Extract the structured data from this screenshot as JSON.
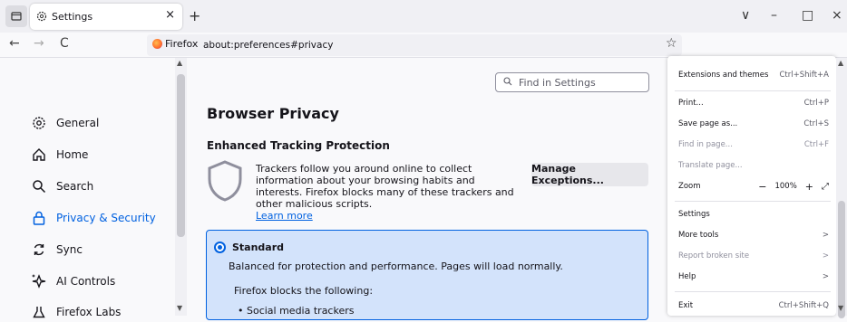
{
  "tab": {
    "title": "Settings",
    "close": "×",
    "new_tab": "+"
  },
  "window": {
    "dropdown": "∨",
    "minimize": "–",
    "restore": "□",
    "close": "×"
  },
  "nav": {
    "back": "←",
    "forward": "→",
    "reload": "C",
    "identity_label": "Firefox",
    "url": "about:preferences#privacy"
  },
  "sidebar": {
    "items": [
      {
        "label": "General",
        "icon": "gear-icon"
      },
      {
        "label": "Home",
        "icon": "home-icon"
      },
      {
        "label": "Search",
        "icon": "search-icon"
      },
      {
        "label": "Privacy & Security",
        "icon": "lock-icon",
        "selected": true
      },
      {
        "label": "Sync",
        "icon": "sync-icon"
      },
      {
        "label": "AI Controls",
        "icon": "sparkle-icon"
      },
      {
        "label": "Firefox Labs",
        "icon": "flask-icon"
      }
    ]
  },
  "main": {
    "search_placeholder": "Find in Settings",
    "heading": "Browser Privacy",
    "etp_title": "Enhanced Tracking Protection",
    "etp_desc": "Trackers follow you around online to collect information about your browsing habits and interests. Firefox blocks many of these trackers and other malicious scripts.",
    "learn_more": "Learn more",
    "manage_exceptions": "Manage Exceptions...",
    "standard": {
      "label": "Standard",
      "desc": "Balanced for protection and performance. Pages will load normally.",
      "blocks_title": "Firefox blocks the following:",
      "item1": "• Social media trackers"
    }
  },
  "menu": {
    "extensions": {
      "label": "Extensions and themes",
      "shortcut": "Ctrl+Shift+A"
    },
    "print": {
      "label": "Print...",
      "shortcut": "Ctrl+P"
    },
    "save_page": {
      "label": "Save page as...",
      "shortcut": "Ctrl+S"
    },
    "find": {
      "label": "Find in page...",
      "shortcut": "Ctrl+F"
    },
    "translate": {
      "label": "Translate page..."
    },
    "zoom": {
      "label": "Zoom",
      "minus": "−",
      "level": "100%",
      "plus": "+"
    },
    "settings": {
      "label": "Settings"
    },
    "more_tools": {
      "label": "More tools",
      "arrow": ">"
    },
    "report": {
      "label": "Report broken site",
      "arrow": ">"
    },
    "help": {
      "label": "Help",
      "arrow": ">"
    },
    "exit": {
      "label": "Exit",
      "shortcut": "Ctrl+Shift+Q"
    }
  },
  "colors": {
    "accent": "#0061e0",
    "selected_card": "#d3e3fb"
  }
}
